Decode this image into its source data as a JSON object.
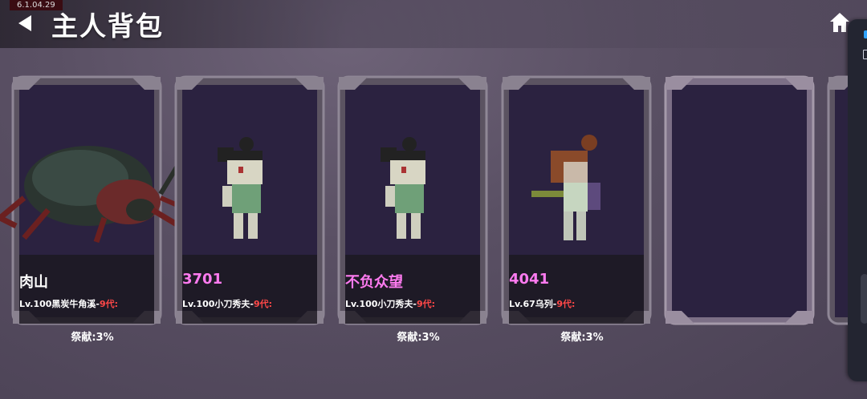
{
  "version": "6.1.04.29",
  "header": {
    "title": "主人背包"
  },
  "colors": {
    "pink_name": "#ff7bf0",
    "white_name": "#ffffff",
    "generation": "#ff4848"
  },
  "cards": [
    {
      "name": "肉山",
      "desc": "Lv.100黑炭牛角溪-",
      "gen": "9代:",
      "contribution": "祭献:3%"
    },
    {
      "name": "3701",
      "desc": "Lv.100小刀秀夫-",
      "gen": "9代:",
      "contribution": ""
    },
    {
      "name": "不负众望",
      "desc": "Lv.100小刀秀夫-",
      "gen": "9代:",
      "contribution": "祭献:3%"
    },
    {
      "name": "4041",
      "desc": "Lv.67乌列-",
      "gen": "9代:",
      "contribution": "祭献:3%"
    }
  ]
}
